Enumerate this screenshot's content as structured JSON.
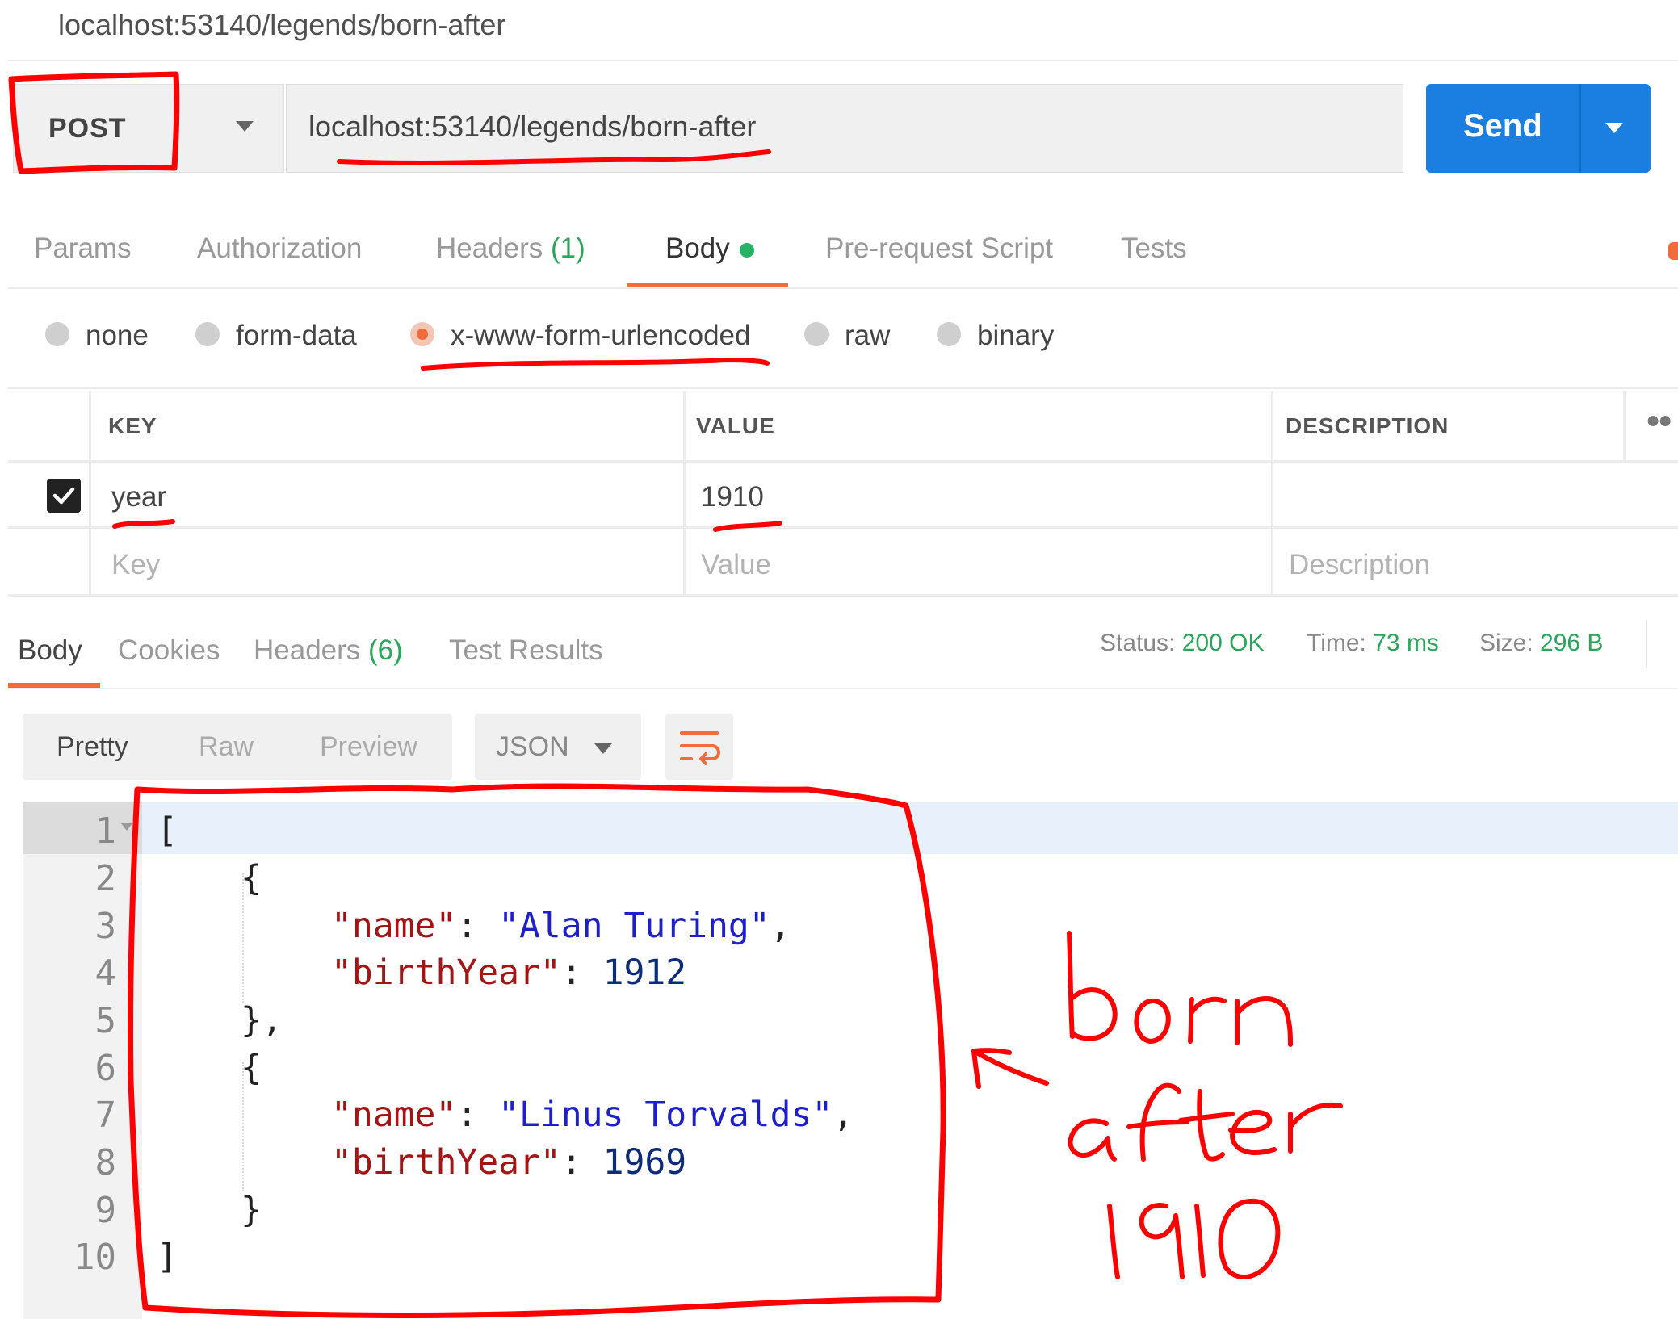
{
  "window": {
    "title": "localhost:53140/legends/born-after"
  },
  "request": {
    "method": "POST",
    "url": "localhost:53140/legends/born-after",
    "send_label": "Send"
  },
  "request_tabs": [
    {
      "label": "Params"
    },
    {
      "label": "Authorization"
    },
    {
      "label": "Headers",
      "count": "(1)"
    },
    {
      "label": "Body",
      "active": true
    },
    {
      "label": "Pre-request Script"
    },
    {
      "label": "Tests"
    }
  ],
  "body_types": [
    {
      "label": "none"
    },
    {
      "label": "form-data"
    },
    {
      "label": "x-www-form-urlencoded",
      "selected": true
    },
    {
      "label": "raw"
    },
    {
      "label": "binary"
    }
  ],
  "kv_table": {
    "headers": {
      "key": "KEY",
      "value": "VALUE",
      "description": "DESCRIPTION"
    },
    "rows": [
      {
        "checked": true,
        "key": "year",
        "value": "1910",
        "description": ""
      }
    ],
    "placeholders": {
      "key": "Key",
      "value": "Value",
      "description": "Description"
    }
  },
  "response_tabs": [
    {
      "label": "Body",
      "active": true
    },
    {
      "label": "Cookies"
    },
    {
      "label": "Headers",
      "count": "(6)"
    },
    {
      "label": "Test Results"
    }
  ],
  "response_status": {
    "status_label": "Status:",
    "status_value": "200 OK",
    "time_label": "Time:",
    "time_value": "73 ms",
    "size_label": "Size:",
    "size_value": "296 B"
  },
  "view_modes": [
    "Pretty",
    "Raw",
    "Preview"
  ],
  "format": "JSON",
  "code": {
    "line_numbers": [
      "1",
      "2",
      "3",
      "4",
      "5",
      "6",
      "7",
      "8",
      "9",
      "10"
    ],
    "open_bracket": "[",
    "close_bracket": "]",
    "open_brace": "{",
    "close_brace_comma": "},",
    "close_brace": "}",
    "name_key": "\"name\"",
    "birth_key": "\"birthYear\"",
    "colon": ": ",
    "comma": ",",
    "items": [
      {
        "name": "\"Alan Turing\"",
        "birthYear": "1912"
      },
      {
        "name": "\"Linus Torvalds\"",
        "birthYear": "1969"
      }
    ]
  },
  "annotation": {
    "words": [
      "born",
      "after",
      "1910"
    ],
    "color": "#ff0000"
  },
  "colors": {
    "accent": "#f26b3a",
    "send": "#1a7fe0",
    "success": "#2aa55a"
  }
}
